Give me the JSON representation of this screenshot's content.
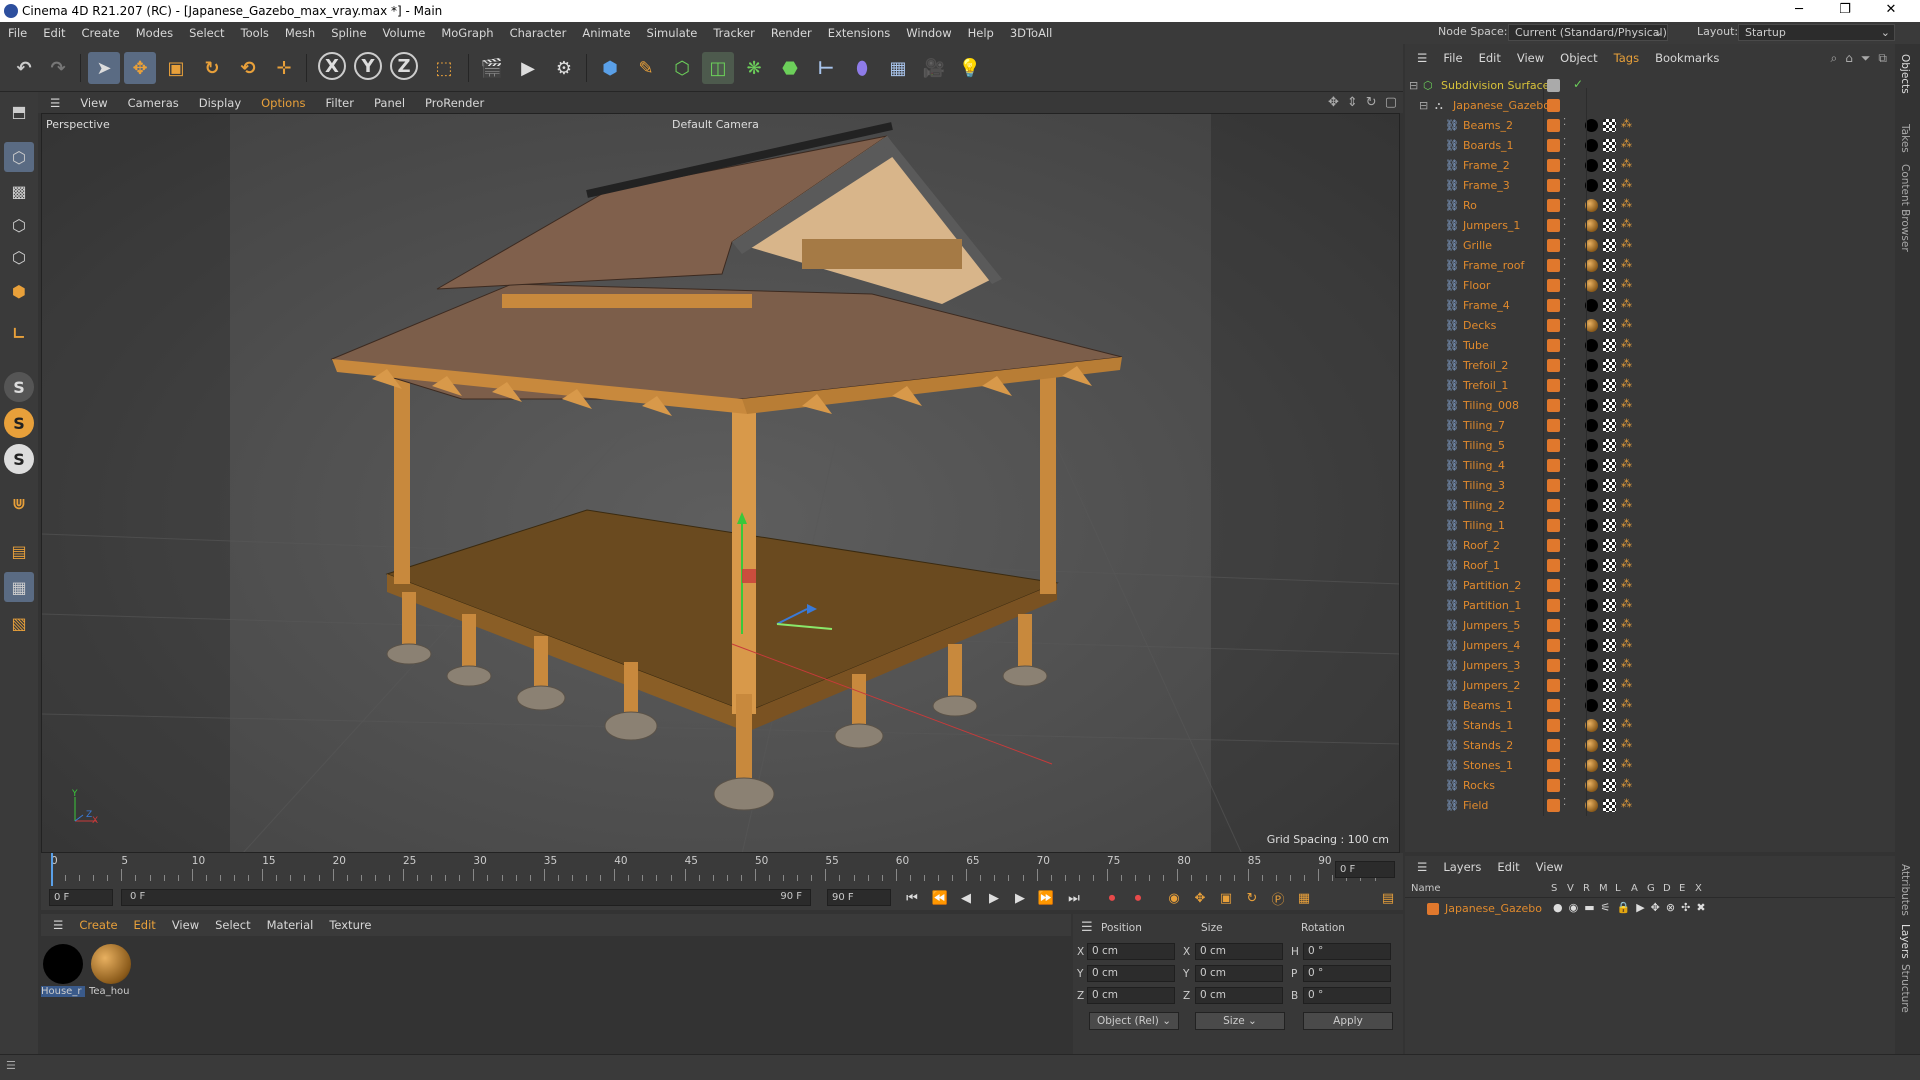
{
  "window": {
    "title": "Cinema 4D R21.207 (RC) - [Japanese_Gazebo_max_vray.max *] - Main",
    "controls": [
      "─",
      "❐",
      "✕"
    ]
  },
  "menubar": {
    "items": [
      "File",
      "Edit",
      "Create",
      "Modes",
      "Select",
      "Tools",
      "Mesh",
      "Spline",
      "Volume",
      "MoGraph",
      "Character",
      "Animate",
      "Simulate",
      "Tracker",
      "Render",
      "Extensions",
      "Window",
      "Help",
      "3DToAll"
    ],
    "node_space_label": "Node Space:",
    "node_space_value": "Current (Standard/Physical)",
    "layout_label": "Layout:",
    "layout_value": "Startup"
  },
  "viewport": {
    "menu": [
      "View",
      "Cameras",
      "Display",
      "Options",
      "Filter",
      "Panel",
      "ProRender"
    ],
    "view_name": "Perspective",
    "camera": "Default Camera",
    "grid_spacing": "Grid Spacing : 100 cm",
    "axis_y": "Y",
    "axis_x": "X",
    "axis_z": "Z"
  },
  "timeline": {
    "ticks": [
      "0",
      "5",
      "10",
      "15",
      "20",
      "25",
      "30",
      "35",
      "40",
      "45",
      "50",
      "55",
      "60",
      "65",
      "70",
      "75",
      "80",
      "85",
      "90"
    ],
    "current_frame": "0 F",
    "start_field": "0 F",
    "range_start": "0 F",
    "range_end": "90 F",
    "end_field": "90 F",
    "end_field2": "90 F"
  },
  "materials": {
    "menu": [
      "Create",
      "Edit",
      "View",
      "Select",
      "Material",
      "Texture"
    ],
    "items": [
      {
        "label": "House_r",
        "color": "#000000"
      },
      {
        "label": "Tea_hou",
        "color": "#b07a2a"
      }
    ]
  },
  "attributes": {
    "headers": [
      "Position",
      "Size",
      "Rotation"
    ],
    "rows": [
      {
        "axis": "X",
        "pos": "0 cm",
        "size_axis": "X",
        "size": "0 cm",
        "rot_axis": "H",
        "rot": "0 °"
      },
      {
        "axis": "Y",
        "pos": "0 cm",
        "size_axis": "Y",
        "size": "0 cm",
        "rot_axis": "P",
        "rot": "0 °"
      },
      {
        "axis": "Z",
        "pos": "0 cm",
        "size_axis": "Z",
        "size": "0 cm",
        "rot_axis": "B",
        "rot": "0 °"
      }
    ],
    "coord_mode": "Object (Rel)",
    "size_mode": "Size",
    "apply": "Apply"
  },
  "object_manager": {
    "menu": [
      "File",
      "Edit",
      "View",
      "Object",
      "Tags",
      "Bookmarks"
    ],
    "root": "Subdivision Surface",
    "group": "Japanese_Gazebo",
    "objects": [
      {
        "name": "Beams_2",
        "mat": "#000000"
      },
      {
        "name": "Boards_1",
        "mat": "#000000"
      },
      {
        "name": "Frame_2",
        "mat": "#000000"
      },
      {
        "name": "Frame_3",
        "mat": "#000000"
      },
      {
        "name": "Ro",
        "mat": "#b07a2a"
      },
      {
        "name": "Jumpers_1",
        "mat": "#b07a2a"
      },
      {
        "name": "Grille",
        "mat": "#b07a2a"
      },
      {
        "name": "Frame_roof",
        "mat": "#b07a2a"
      },
      {
        "name": "Floor",
        "mat": "#b07a2a"
      },
      {
        "name": "Frame_4",
        "mat": "#000000"
      },
      {
        "name": "Decks",
        "mat": "#b07a2a"
      },
      {
        "name": "Tube",
        "mat": "#000000"
      },
      {
        "name": "Trefoil_2",
        "mat": "#000000"
      },
      {
        "name": "Trefoil_1",
        "mat": "#000000"
      },
      {
        "name": "Tiling_008",
        "mat": "#000000"
      },
      {
        "name": "Tiling_7",
        "mat": "#000000"
      },
      {
        "name": "Tiling_5",
        "mat": "#000000"
      },
      {
        "name": "Tiling_4",
        "mat": "#000000"
      },
      {
        "name": "Tiling_3",
        "mat": "#000000"
      },
      {
        "name": "Tiling_2",
        "mat": "#000000"
      },
      {
        "name": "Tiling_1",
        "mat": "#000000"
      },
      {
        "name": "Roof_2",
        "mat": "#000000"
      },
      {
        "name": "Roof_1",
        "mat": "#000000"
      },
      {
        "name": "Partition_2",
        "mat": "#000000"
      },
      {
        "name": "Partition_1",
        "mat": "#000000"
      },
      {
        "name": "Jumpers_5",
        "mat": "#000000"
      },
      {
        "name": "Jumpers_4",
        "mat": "#000000"
      },
      {
        "name": "Jumpers_3",
        "mat": "#000000"
      },
      {
        "name": "Jumpers_2",
        "mat": "#000000"
      },
      {
        "name": "Beams_1",
        "mat": "#000000"
      },
      {
        "name": "Stands_1",
        "mat": "#b07a2a"
      },
      {
        "name": "Stands_2",
        "mat": "#b07a2a"
      },
      {
        "name": "Stones_1",
        "mat": "#b07a2a"
      },
      {
        "name": "Rocks",
        "mat": "#b07a2a"
      },
      {
        "name": "Field",
        "mat": "#b07a2a"
      }
    ]
  },
  "layers": {
    "menu": [
      "Layers",
      "Edit",
      "View"
    ],
    "columns": [
      "Name",
      "S",
      "V",
      "R",
      "M",
      "L",
      "A",
      "G",
      "D",
      "E",
      "X"
    ],
    "rows": [
      {
        "name": "Japanese_Gazebo"
      }
    ]
  },
  "side_tabs": [
    "Objects",
    "Takes",
    "Content Browser",
    "Attributes",
    "Layers",
    "Structure"
  ],
  "colors": {
    "accent": "#e08a2d",
    "object_name": "#e08a2d",
    "root_name": "#d7c23a"
  }
}
